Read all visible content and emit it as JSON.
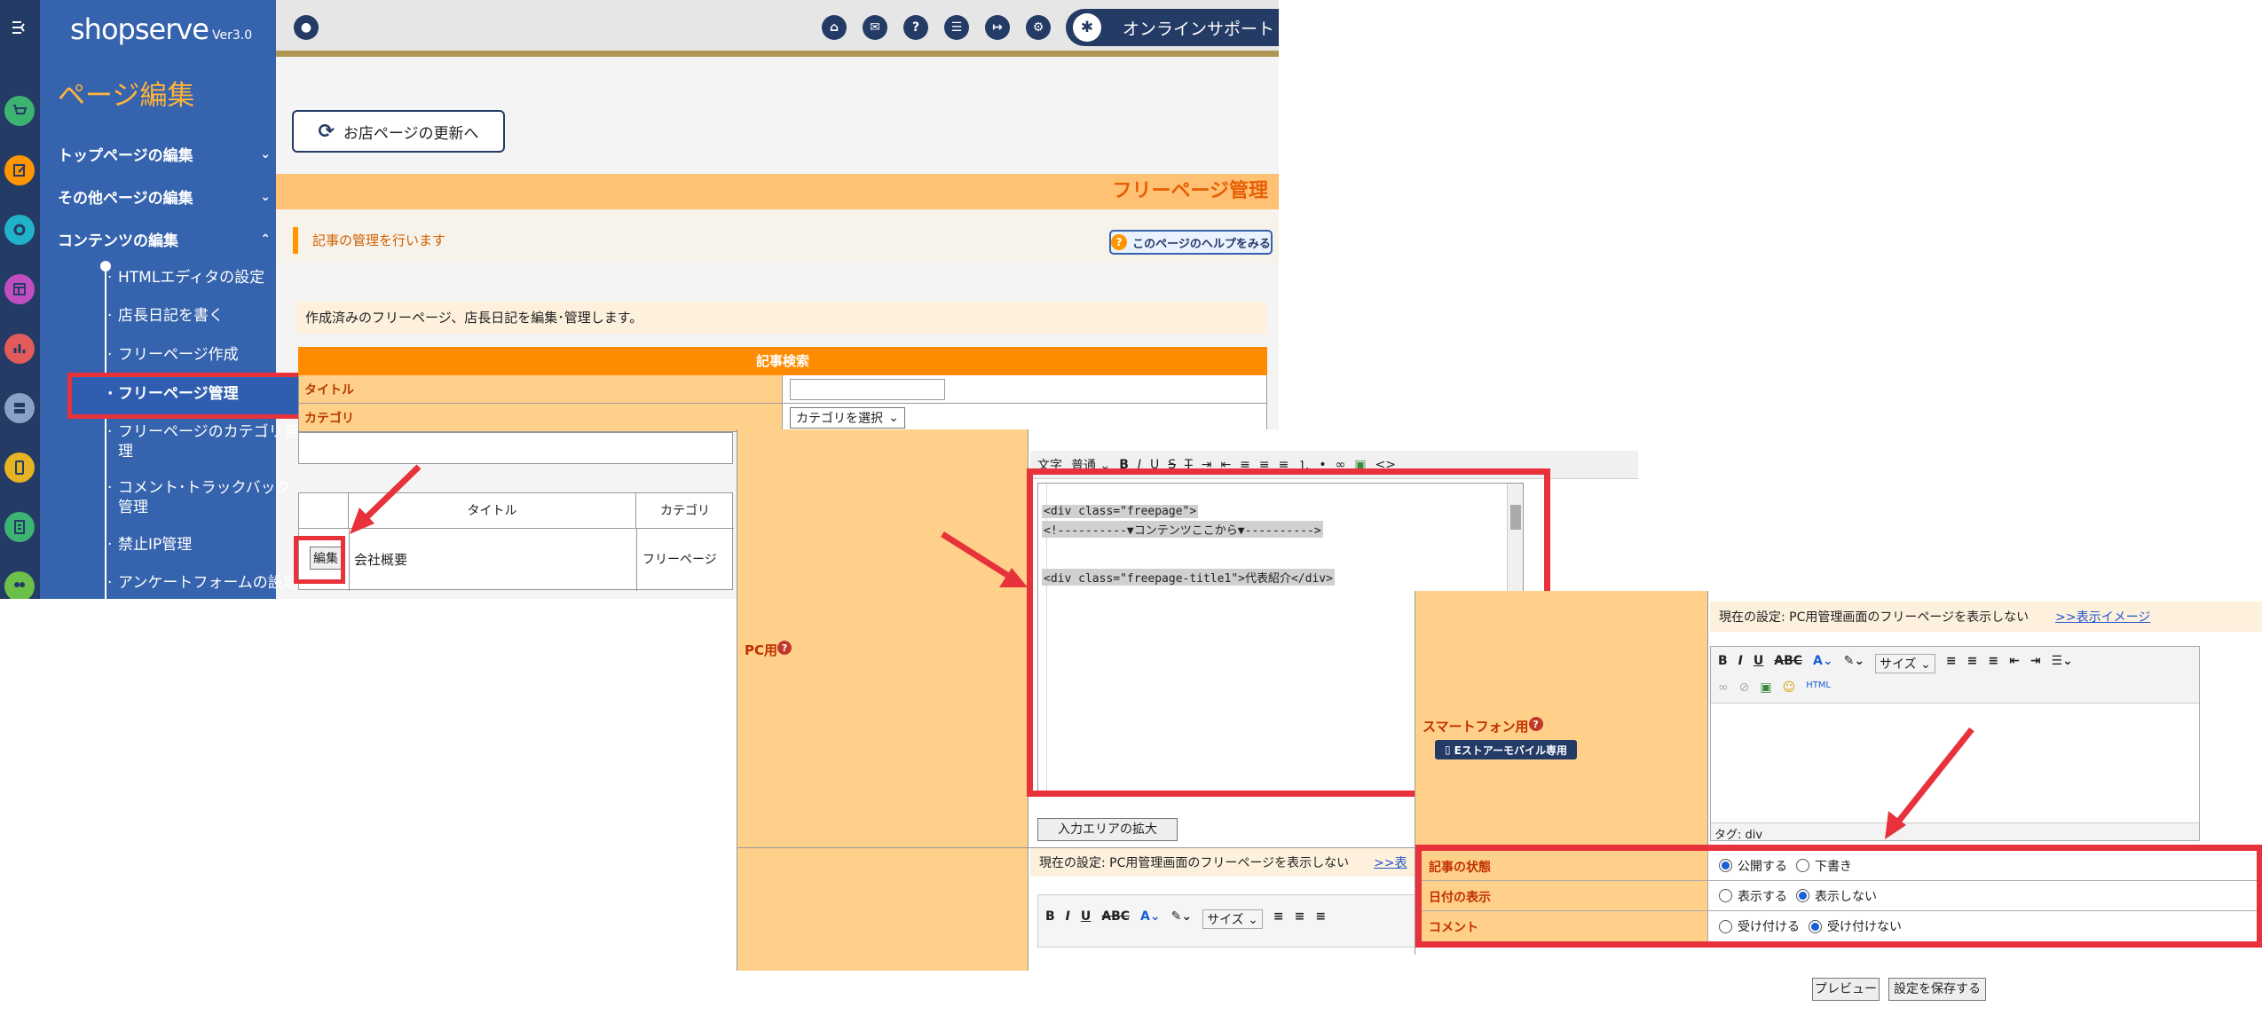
{
  "sidebar": {
    "logo": "shopserve",
    "version": "Ver3.0",
    "title": "ページ編集",
    "groups": [
      {
        "label": "トップページの編集"
      },
      {
        "label": "その他ページの編集"
      },
      {
        "label": "コンテンツの編集"
      }
    ],
    "items": [
      {
        "label": "HTMLエディタの設定"
      },
      {
        "label": "店長日記を書く"
      },
      {
        "label": "フリーページ作成"
      },
      {
        "label": "フリーページ管理"
      },
      {
        "label": "フリーページのカテゴリ管理"
      },
      {
        "label": "コメント･トラックバック管理"
      },
      {
        "label": "禁止IP管理"
      },
      {
        "label": "アンケートフォームの設定"
      }
    ]
  },
  "header": {
    "support_label": "オンラインサポート"
  },
  "main": {
    "refresh_button": "お店ページの更新へ",
    "section_title": "フリーページ管理",
    "note": "記事の管理を行います",
    "help_button": "このページのヘルプをみる",
    "description": "作成済みのフリーページ、店長日記を編集･管理します。",
    "search": {
      "heading": "記事検索",
      "title_label": "タイトル",
      "category_label": "カテゴリ",
      "category_select": "カテゴリを選択"
    },
    "list": {
      "col_title": "タイトル",
      "col_category": "カテゴリ",
      "edit_button": "編集",
      "row_title": "会社概要",
      "row_category": "フリーページ"
    }
  },
  "editor_pc": {
    "label": "PC用",
    "toolbar": {
      "font": "文字",
      "style": "普通"
    },
    "code_lines": [
      "<div class=\"freepage\">",
      "<!----------▼コンテンツここから▼---------->",
      "<div class=\"freepage-title1\">代表紹介</div>"
    ],
    "expand_button": "入力エリアの拡大",
    "current_setting": "現在の設定: PC用管理画面のフリーページを表示しない",
    "link_text": ">>表",
    "size_label": "サイズ"
  },
  "editor_sp": {
    "label": "スマートフォン用",
    "badge": "Eストアーモバイル専用",
    "current_setting": "現在の設定: PC用管理画面のフリーページを表示しない",
    "link_text": ">>表示イメージ",
    "size_label": "サイズ",
    "tag_line": "タグ: div"
  },
  "status": {
    "rows": [
      {
        "label": "記事の状態",
        "opt1": "公開する",
        "opt2": "下書き",
        "selected": 1
      },
      {
        "label": "日付の表示",
        "opt1": "表示する",
        "opt2": "表示しない",
        "selected": 2
      },
      {
        "label": "コメント",
        "opt1": "受け付ける",
        "opt2": "受け付けない",
        "selected": 2
      }
    ]
  },
  "actions": {
    "preview": "プレビュー",
    "save": "設定を保存する"
  },
  "colors": {
    "highlight": "#e8323b",
    "sidebar": "#3563ad",
    "header_band": "#ffc274",
    "accent": "#ff8c00"
  }
}
